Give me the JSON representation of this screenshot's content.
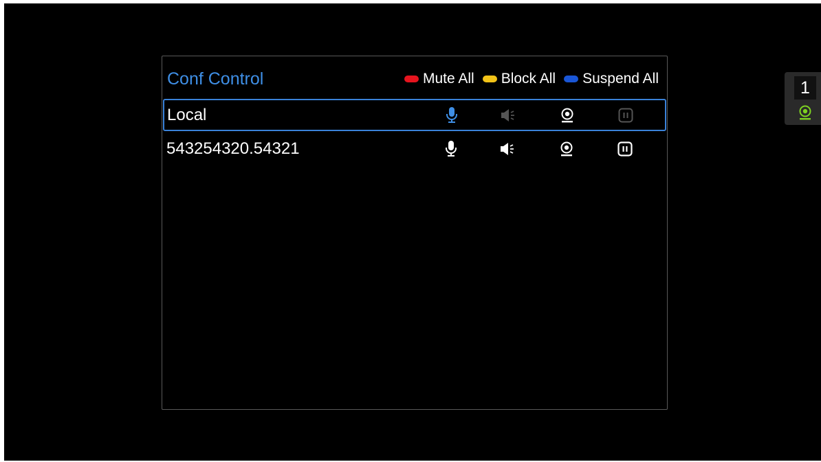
{
  "panel": {
    "title": "Conf Control",
    "legend": [
      {
        "label": "Mute All",
        "color": "#e6141e"
      },
      {
        "label": "Block All",
        "color": "#f2c318"
      },
      {
        "label": "Suspend All",
        "color": "#1a56d6"
      }
    ]
  },
  "participants": [
    {
      "name": "Local",
      "selected": true,
      "controls": {
        "microphone": {
          "icon": "microphone-icon",
          "state": "active",
          "color": "#3f8fe6"
        },
        "speaker": {
          "icon": "speaker-icon",
          "state": "disabled",
          "color": "#555555"
        },
        "camera": {
          "icon": "webcam-icon",
          "state": "normal",
          "color": "#ffffff"
        },
        "pause": {
          "icon": "pause-icon",
          "state": "disabled",
          "color": "#555555"
        }
      }
    },
    {
      "name": "543254320.54321",
      "selected": false,
      "controls": {
        "microphone": {
          "icon": "microphone-icon",
          "state": "normal",
          "color": "#ffffff"
        },
        "speaker": {
          "icon": "speaker-icon",
          "state": "normal",
          "color": "#ffffff"
        },
        "camera": {
          "icon": "webcam-icon",
          "state": "normal",
          "color": "#ffffff"
        },
        "pause": {
          "icon": "pause-icon",
          "state": "normal",
          "color": "#ffffff"
        }
      }
    }
  ],
  "side_badge": {
    "count": "1",
    "icon": "webcam-icon",
    "icon_color": "#7ed321"
  }
}
